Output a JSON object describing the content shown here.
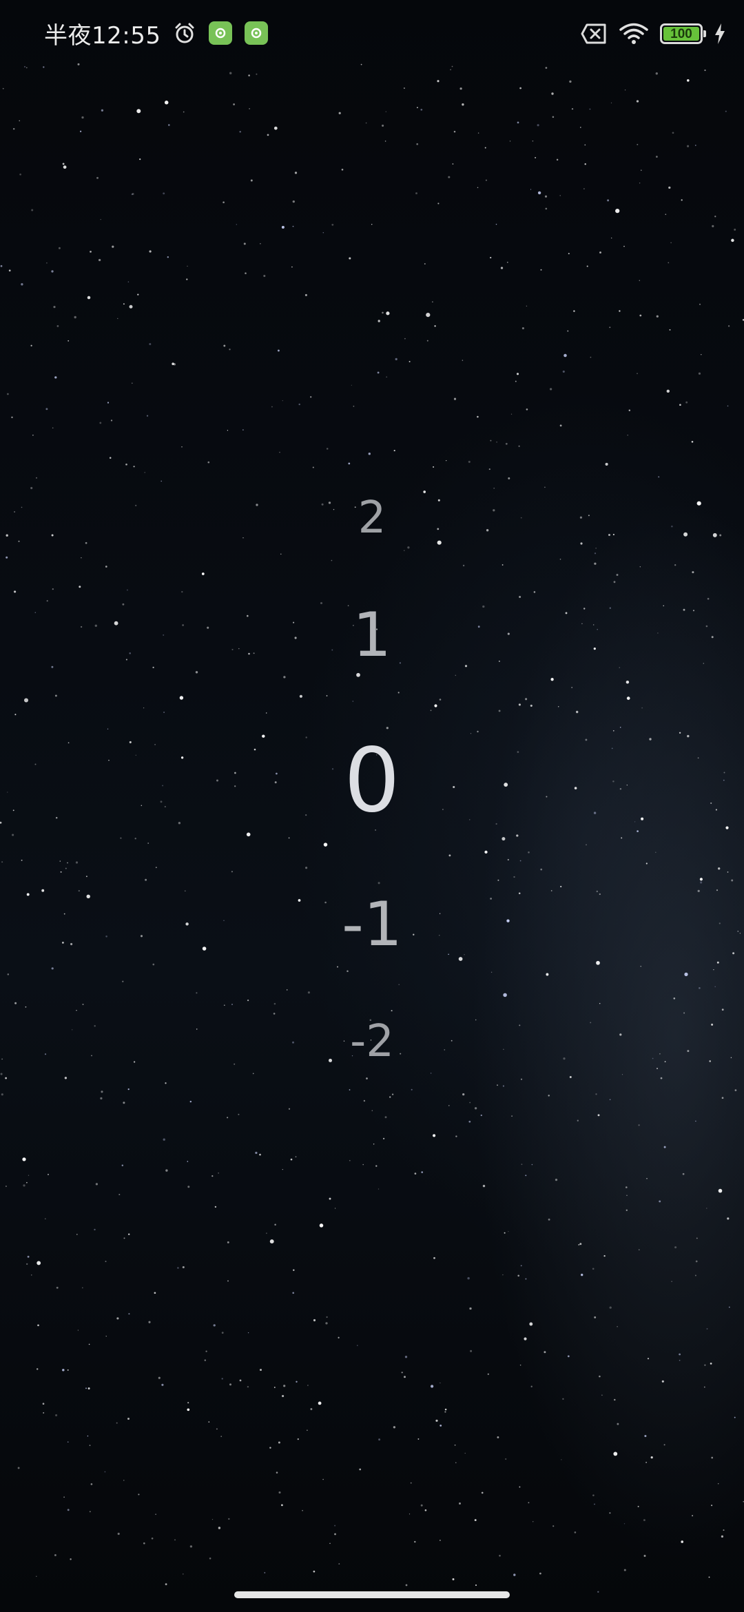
{
  "status_bar": {
    "time": "半夜12:55",
    "icons": [
      "alarm-icon",
      "app-notification-icon",
      "app-notification-icon",
      "sim-error-icon",
      "wifi-icon",
      "battery-icon",
      "charging-icon"
    ],
    "battery_level": "100",
    "battery_color": "#67c23a"
  },
  "picker": {
    "items": [
      "2",
      "1",
      "0",
      "-1",
      "-2"
    ],
    "selected": "0"
  },
  "colors": {
    "background": "#05070b",
    "picker_text": "#c9cbcf"
  }
}
